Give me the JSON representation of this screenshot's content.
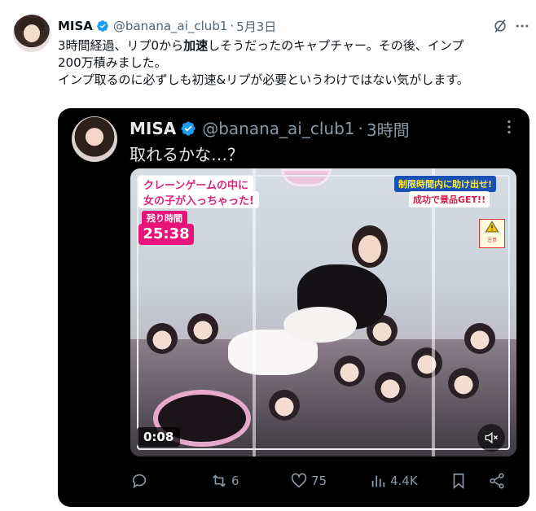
{
  "tweet": {
    "author_name": "MISA",
    "handle": "@banana_ai_club1",
    "separator": "·",
    "date": "5月3日",
    "text_line1_a": "3時間経過、リプ0から",
    "text_line1_bold": "加速",
    "text_line1_b": "しそうだったのキャプチャー。その後、インプ",
    "text_line2": "200万積みました。",
    "text_line3": "インプ取るのに必ずしも初速&リプが必要というわけではない気がします。"
  },
  "quote": {
    "author_name": "MISA",
    "handle": "@banana_ai_club1",
    "separator": "·",
    "time": "3時間",
    "text": "取れるかな…？",
    "video": {
      "overlay_left_1": "クレーンゲームの中に",
      "overlay_left_2": "女の子が入っちゃった!",
      "overlay_right_1": "制限時間内に助け出せ!",
      "overlay_right_2": "成功で景品GET!!",
      "timer_label": "残り時間",
      "timer_value": "25:38",
      "sign_text": "注意",
      "elapsed": "0:08"
    },
    "actions": {
      "reply_count": "",
      "retweet_count": "6",
      "like_count": "75",
      "views_count": "4.4K"
    }
  },
  "icons": {
    "verified": "verified-badge-icon",
    "grok": "grok-icon",
    "more": "more-icon",
    "reply": "reply-icon",
    "retweet": "retweet-icon",
    "like": "heart-icon",
    "views": "views-icon",
    "bookmark": "bookmark-icon",
    "share": "share-icon",
    "mute": "mute-icon"
  },
  "colors": {
    "verified": "#1d9bf0",
    "quote_bg": "#000000",
    "secondary_text": "#536471",
    "dark_secondary": "#8b98a5"
  }
}
